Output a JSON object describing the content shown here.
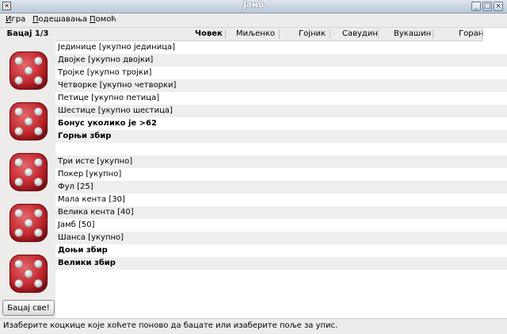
{
  "window": {
    "title": "Јамб"
  },
  "menu": [
    "Игра",
    "Подешавања",
    "Помоћ"
  ],
  "left": {
    "roll_label": "Бацај 1/3",
    "roll_all": "Бацај све!"
  },
  "dice": [
    {
      "value": 5,
      "color": "#c0232b"
    },
    {
      "value": 5,
      "color": "#c0232b"
    },
    {
      "value": 5,
      "color": "#c0232b"
    },
    {
      "value": 5,
      "color": "#c0232b"
    },
    {
      "value": 5,
      "color": "#c0232b"
    }
  ],
  "columns": [
    "Човек",
    "Миљенко",
    "Гојник",
    "Савудин",
    "Вукашин",
    "Горан"
  ],
  "rows": [
    {
      "label": "Јединице [укупно јединица]",
      "bold": false
    },
    {
      "label": "Двојке [укупно двојки]",
      "bold": false
    },
    {
      "label": "Тројке [укупно тројки]",
      "bold": false
    },
    {
      "label": "Четворке [укупно четворки]",
      "bold": false
    },
    {
      "label": "Петице [укупно петица]",
      "bold": false
    },
    {
      "label": "Шестице [укупно шестица]",
      "bold": false
    },
    {
      "label": "Бонус уколико је >62",
      "bold": true
    },
    {
      "label": "Горњи збир",
      "bold": true
    },
    {
      "label": "",
      "bold": false
    },
    {
      "label": "Три исте [укупно]",
      "bold": false
    },
    {
      "label": "Покер [укупно]",
      "bold": false
    },
    {
      "label": "Фул [25]",
      "bold": false
    },
    {
      "label": "Мала кента [30]",
      "bold": false
    },
    {
      "label": "Велика кента [40]",
      "bold": false
    },
    {
      "label": "Јамб [50]",
      "bold": false
    },
    {
      "label": "Шанса [укупно]",
      "bold": false
    },
    {
      "label": "Доњи збир",
      "bold": true
    },
    {
      "label": "Велики збир",
      "bold": true
    }
  ],
  "status": "Изаберите коцкице које хоћете поново да бацате или изаберите поље за упис."
}
